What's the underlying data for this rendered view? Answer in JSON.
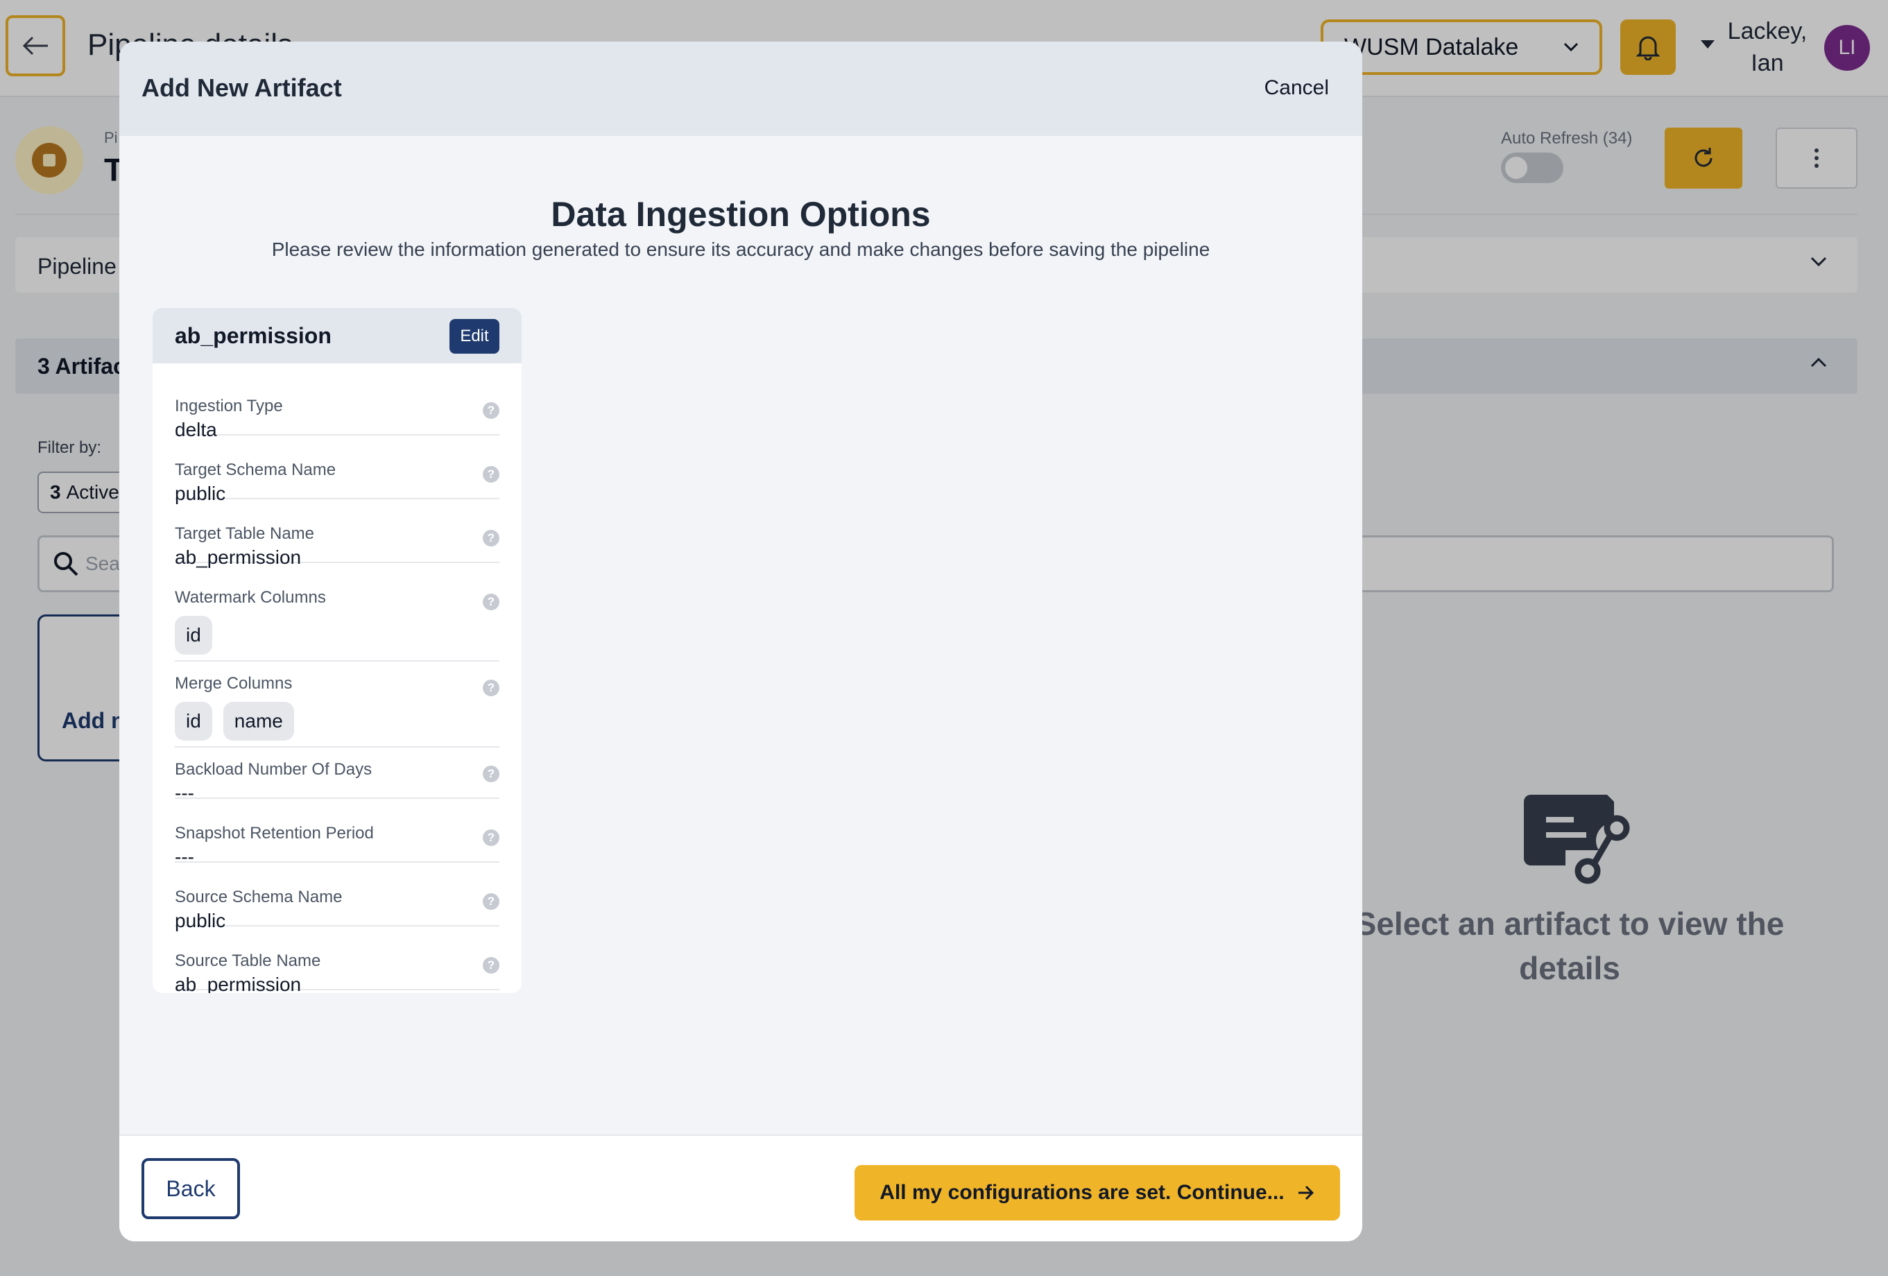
{
  "header": {
    "page_title": "Pipeline details",
    "workspace_selected": "WUSM Datalake",
    "user_name_line1": "Lackey,",
    "user_name_line2": "Ian",
    "avatar_initials": "LI"
  },
  "pipeline": {
    "small_label": "Pi",
    "title": "T",
    "auto_refresh_label": "Auto Refresh (34)",
    "auto_refresh_on": false
  },
  "sections": {
    "pipeline_panel_label": "Pipeline",
    "artifacts_header": "3 Artifac",
    "filter_label": "Filter by:",
    "active_count": "3",
    "active_label": "Active",
    "search_placeholder": "Sear",
    "add_card_label": "Add n",
    "detail_placeholder": "Select an artifact to view the details"
  },
  "modal": {
    "title": "Add New Artifact",
    "cancel_label": "Cancel",
    "heading": "Data Ingestion Options",
    "subheading": "Please review the information generated to ensure its accuracy and make changes before saving the pipeline",
    "card": {
      "title": "ab_permission",
      "edit_label": "Edit",
      "fields": [
        {
          "label": "Ingestion Type",
          "value": "delta"
        },
        {
          "label": "Target Schema Name",
          "value": "public"
        },
        {
          "label": "Target Table Name",
          "value": "ab_permission"
        },
        {
          "label": "Watermark Columns",
          "chips": [
            "id"
          ]
        },
        {
          "label": "Merge Columns",
          "chips": [
            "id",
            "name"
          ]
        },
        {
          "label": "Backload Number Of Days",
          "value": "---"
        },
        {
          "label": "Snapshot Retention Period",
          "value": "---"
        },
        {
          "label": "Source Schema Name",
          "value": "public"
        },
        {
          "label": "Source Table Name",
          "value": "ab_permission"
        }
      ]
    },
    "back_label": "Back",
    "continue_label": "All my configurations are set. Continue..."
  },
  "colors": {
    "accent_yellow": "#f0b429",
    "navy": "#1e3a6e",
    "avatar_purple": "#7b2d8e"
  },
  "icons": [
    "arrow-left-icon",
    "chevron-down-icon",
    "bell-icon",
    "refresh-icon",
    "more-vertical-icon",
    "search-icon",
    "help-icon",
    "artifact-flow-icon",
    "arrow-right-icon"
  ]
}
